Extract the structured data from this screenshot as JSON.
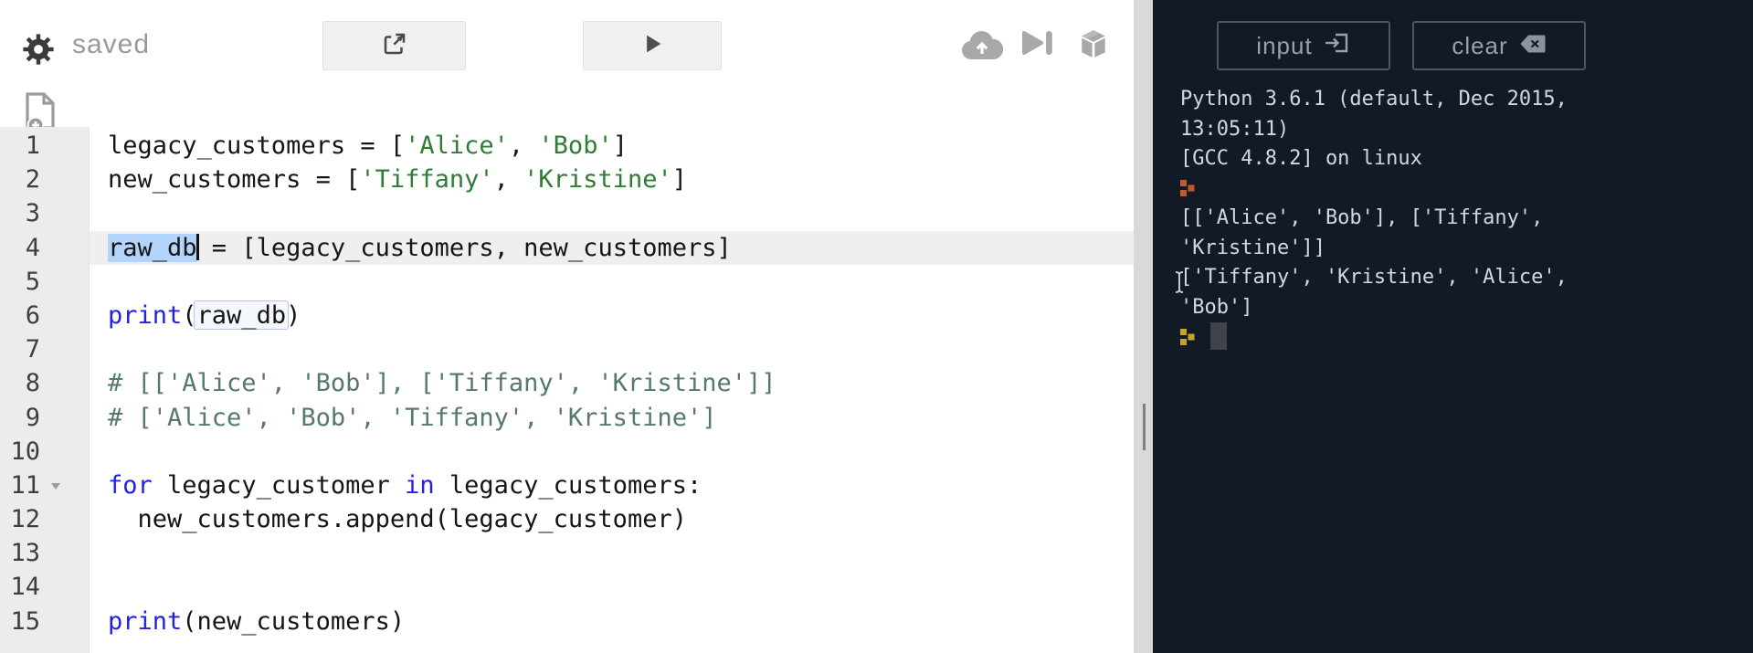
{
  "toolbar": {
    "status_label": "saved",
    "icons": [
      "gear-icon",
      "share-icon",
      "run-play-icon",
      "cloud-upload-icon",
      "step-forward-icon",
      "package-cube-icon",
      "new-file-icon"
    ]
  },
  "editor": {
    "active_line": 4,
    "selected_text": "raw_db",
    "lines": [
      {
        "num": "1",
        "tokens": [
          "legacy_customers = [",
          "'Alice'",
          ", ",
          "'Bob'",
          "]"
        ]
      },
      {
        "num": "2",
        "tokens": [
          "new_customers = [",
          "'Tiffany'",
          ", ",
          "'Kristine'",
          "]"
        ]
      },
      {
        "num": "3",
        "tokens": []
      },
      {
        "num": "4",
        "tokens": [
          "raw_db",
          " = [legacy_customers, new_customers]"
        ]
      },
      {
        "num": "5",
        "tokens": []
      },
      {
        "num": "6",
        "tokens": [
          "print",
          "(",
          "raw_db",
          ")"
        ]
      },
      {
        "num": "7",
        "tokens": []
      },
      {
        "num": "8",
        "tokens": [
          "# [['Alice', 'Bob'], ['Tiffany', 'Kristine']]"
        ]
      },
      {
        "num": "9",
        "tokens": [
          "# ['Alice', 'Bob', 'Tiffany', 'Kristine']"
        ]
      },
      {
        "num": "10",
        "tokens": []
      },
      {
        "num": "11",
        "tokens": [
          "for",
          " legacy_customer ",
          "in",
          " legacy_customers:"
        ]
      },
      {
        "num": "12",
        "tokens": [
          "  new_customers.append(legacy_customer)"
        ]
      },
      {
        "num": "13",
        "tokens": []
      },
      {
        "num": "14",
        "tokens": []
      },
      {
        "num": "15",
        "tokens": [
          "print",
          "(new_customers)"
        ]
      }
    ]
  },
  "console": {
    "input_button": {
      "label": "input",
      "icon": "enter-input-icon"
    },
    "clear_button": {
      "label": "clear",
      "icon": "backspace-icon"
    },
    "lines": [
      {
        "type": "text",
        "text": "Python 3.6.1 (default, Dec 2015,"
      },
      {
        "type": "text",
        "text": "13:05:11)"
      },
      {
        "type": "text",
        "text": "[GCC 4.8.2] on linux"
      },
      {
        "type": "prompt",
        "text": ""
      },
      {
        "type": "text",
        "text": "[['Alice', 'Bob'], ['Tiffany',"
      },
      {
        "type": "text",
        "text": "'Kristine']]"
      },
      {
        "type": "text",
        "text": "['Tiffany', 'Kristine', 'Alice',"
      },
      {
        "type": "text",
        "text": "'Bob']"
      },
      {
        "type": "prompt-cursor",
        "text": ""
      }
    ]
  },
  "colors": {
    "console_background": "#121a28",
    "console_text": "#d4d8de",
    "prompt_orange": "#bf5b2d",
    "prompt_gold": "#c9a227",
    "string_green": "#2e7d32",
    "keyword_blue": "#2222e0",
    "comment_green": "#55796a",
    "selection_blue": "#b3d4fc",
    "gutter_gray": "#ececec",
    "active_line_gray": "#efefef"
  }
}
